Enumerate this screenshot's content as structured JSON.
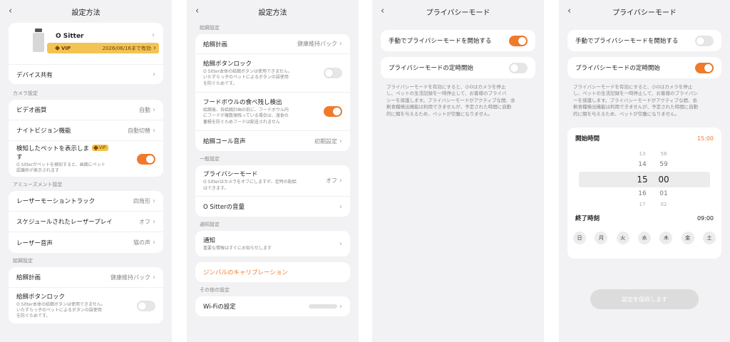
{
  "panel1": {
    "title": "設定方法",
    "device": {
      "name": "O Sitter",
      "vip_tag": "VIP",
      "vip_expiry": "2026/06/16まで有効"
    },
    "share_label": "デバイス共有",
    "camera_section": "カメラ設定",
    "video_quality": {
      "label": "ビデオ画質",
      "value": "自動"
    },
    "night_vision": {
      "label": "ナイトビジョン機能",
      "value": "自動切替"
    },
    "show_pet": {
      "label_line1": "検知したペットを表示しま",
      "label_line2": "す",
      "vip": "VIP",
      "sub_line1": "O Sitterがペットを検知すると、画面にペット",
      "sub_line2": "認識枠が表示されます"
    },
    "amusement_section": "アミューズメント設定",
    "laser_track": {
      "label": "レーザーモーショントラック",
      "value": "四角形"
    },
    "laser_schedule": {
      "label": "スケジュールされたレーザープレイ",
      "value": "オフ"
    },
    "laser_sound": {
      "label": "レーザー音声",
      "value": "猫の声"
    },
    "feed_section": "給餌設定",
    "feed_plan": {
      "label": "給餌計画",
      "value": "健康維持パック"
    },
    "feed_lock": {
      "label": "給餌ボタンロック",
      "sub_line1": "O Sitter本体の給餌ボタンは使用できません。",
      "sub_line2": "いたずらっ子のペットによるボタンの誤使用",
      "sub_line3": "を防ぐためです。"
    }
  },
  "panel2": {
    "title": "設定方法",
    "feed_section": "給餌設定",
    "feed_plan": {
      "label": "給餌計画",
      "value": "健康維持パック"
    },
    "feed_lock": {
      "label": "給餌ボタンロック",
      "sub_line1": "O Sitter本体の給餌ボタンは使用できません。",
      "sub_line2": "いたずらっ子のペットによるボタンの誤使用",
      "sub_line3": "を防ぐためです。"
    },
    "leftover": {
      "label": "フードボウルの食べ残し検出",
      "sub_line1": "給餌後、各給餌計画の前に、フードボウル内",
      "sub_line2": "にフードが複数個残っている場合は、溜食の",
      "sub_line3": "蓄積を防ぐためフードは配送されません"
    },
    "feed_call": {
      "label": "給餌コール音声",
      "value": "初期設定"
    },
    "general_section": "一般設定",
    "privacy": {
      "label": "プライバシーモード",
      "value": "オフ",
      "sub_line1": "O Sitterはカメラをオフにしますが、定時の配給",
      "sub_line2": "はできます。"
    },
    "volume_label": "O Sitterの音量",
    "notify_section": "通知設定",
    "notify": {
      "label": "通知",
      "sub": "重要な情報はすぐにお知らせします"
    },
    "gimbal_label": "ジンバルのキャリブレーション",
    "other_section": "その他の設定",
    "wifi_label": "Wi-Fiの設定"
  },
  "panel3": {
    "title": "プライバシーモード",
    "manual_label": "手動でプライバシーモードを開始する",
    "scheduled_label": "プライバシーモードの定時開始",
    "desc_line1": "プライバシーモードを有効にすると、小Oはカメラを停止",
    "desc_line2": "し、ペットの生活記録を一時停止して、お客様のプライバ",
    "desc_line3": "シーを保護します。プライバシーモードがアクティブな間、余",
    "desc_line4": "剰食糧検出機能は利用できませんが、予定された時間に自動",
    "desc_line5": "的に餌を与えるため、ペットが空腹になりません。"
  },
  "panel4": {
    "title": "プライバシーモード",
    "manual_label": "手動でプライバシーモードを開始する",
    "scheduled_label": "プライバシーモードの定時開始",
    "desc_line1": "プライバシーモードを有効にすると、小Oはカメラを停止",
    "desc_line2": "し、ペットの生活記録を一時停止して、お客様のプライバシ",
    "desc_line3": "ーを保護します。プライバシーモードがアクティブな間、余",
    "desc_line4": "剰食糧検出機能は利用できませんが、予定された時間に自動",
    "desc_line5": "的に餌を与えるため、ペットが空腹になりません。",
    "start_label": "開始時間",
    "start_value": "15:00",
    "picker_hours": [
      "13",
      "14",
      "15",
      "16",
      "17"
    ],
    "picker_minutes": [
      "58",
      "59",
      "00",
      "01",
      "02"
    ],
    "end_label": "終了時刻",
    "end_value": "09:00",
    "days": [
      "日",
      "月",
      "火",
      "水",
      "木",
      "金",
      "土"
    ],
    "save_label": "設定を保存します"
  },
  "colors": {
    "accent": "#f07a2a",
    "vip_gold": "#f3c455",
    "background": "#f2f2f4"
  }
}
